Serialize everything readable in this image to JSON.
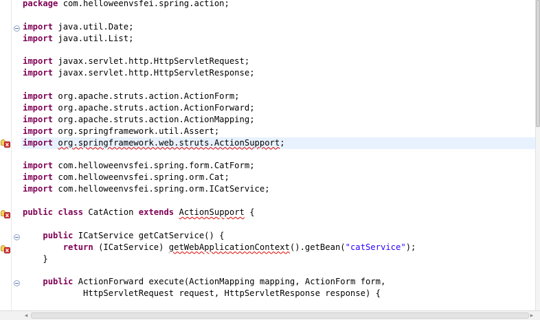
{
  "editor": {
    "lines": {
      "l1": {
        "kw": "package",
        "text": " com.helloweenvsfei.spring.action;"
      },
      "l3": {
        "kw": "import",
        "text": " java.util.Date;"
      },
      "l4": {
        "kw": "import",
        "text": " java.util.List;"
      },
      "l6": {
        "kw": "import",
        "text": " javax.servlet.http.HttpServletRequest;"
      },
      "l7": {
        "kw": "import",
        "text": " javax.servlet.http.HttpServletResponse;"
      },
      "l9": {
        "kw": "import",
        "text": " org.apache.struts.action.ActionForm;"
      },
      "l10": {
        "kw": "import",
        "text": " org.apache.struts.action.ActionForward;"
      },
      "l11": {
        "kw": "import",
        "text": " org.apache.struts.action.ActionMapping;"
      },
      "l12": {
        "kw": "import",
        "text": " org.springframework.util.Assert;"
      },
      "l13": {
        "kw": "import",
        "space": " ",
        "err": "org.springframework.web.struts.ActionSupport",
        "tail": ";"
      },
      "l15": {
        "kw": "import",
        "text": " com.helloweenvsfei.spring.form.CatForm;"
      },
      "l16": {
        "kw": "import",
        "text": " com.helloweenvsfei.spring.orm.Cat;"
      },
      "l17": {
        "kw": "import",
        "text": " com.helloweenvsfei.spring.orm.ICatService;"
      },
      "l19": {
        "kw1": "public",
        "sp1": " ",
        "kw2": "class",
        "text": " CatAction ",
        "kw3": "extends",
        "sp2": " ",
        "err": "ActionSupport",
        "tail": " {"
      },
      "l21": {
        "indent": "    ",
        "kw": "public",
        "text": " ICatService getCatService() {"
      },
      "l22": {
        "indent": "        ",
        "kw": "return",
        "text": " (ICatService) ",
        "err": "getWebApplicationContext",
        "mid": "().getBean(",
        "str": "\"catService\"",
        "tail": ");"
      },
      "l23": {
        "text": "    }"
      },
      "l25": {
        "indent": "    ",
        "kw": "public",
        "text": " ActionForward execute(ActionMapping mapping, ActionForm form,"
      },
      "l26": {
        "text": "            HttpServletRequest request, HttpServletResponse response) {"
      }
    }
  },
  "markers": {
    "fold_icon": "fold-collapse-icon",
    "warning_icon": "quickfix-error-icon"
  },
  "colors": {
    "keyword": "#7f0055",
    "string": "#2a00ff",
    "current_line": "#e8f2fe",
    "error_underline": "#e00000"
  },
  "scrollbar": {
    "left_arrow": "◂",
    "right_arrow": "▸"
  }
}
